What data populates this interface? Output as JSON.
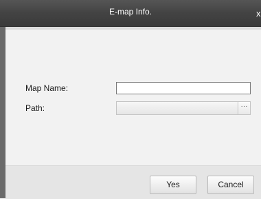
{
  "dialog": {
    "title": "E-map Info.",
    "close_glyph": "x"
  },
  "form": {
    "map_name_label": "Map Name:",
    "map_name_value": "",
    "path_label": "Path:",
    "path_value": "",
    "browse_glyph": "···"
  },
  "buttons": {
    "yes_label": "Yes",
    "cancel_label": "Cancel"
  }
}
